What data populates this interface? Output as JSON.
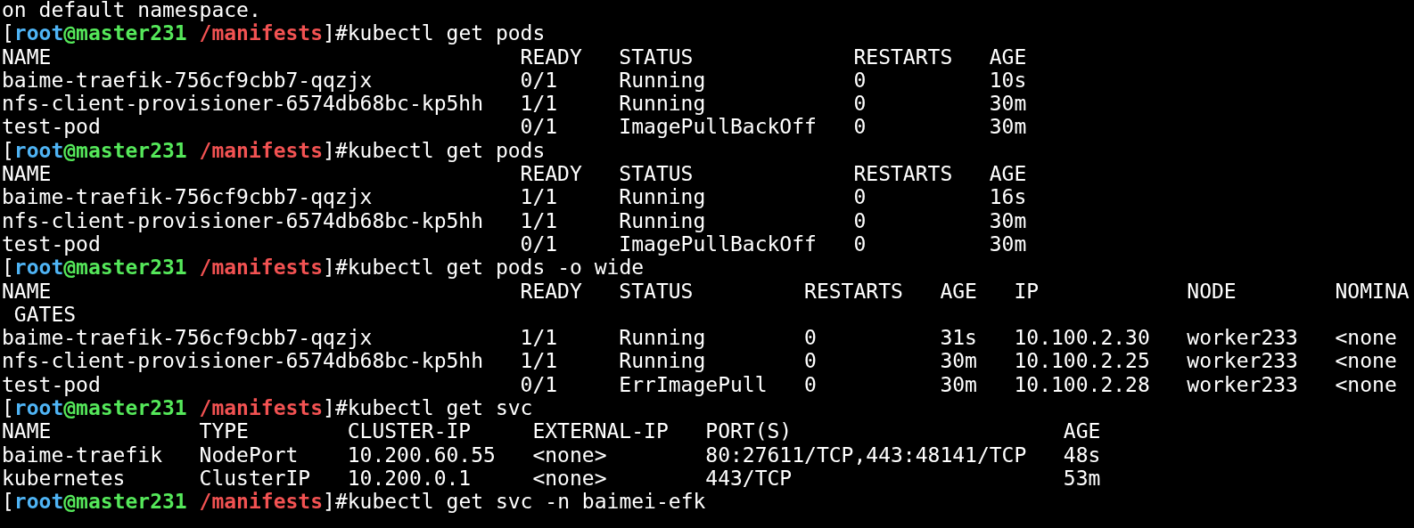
{
  "terminal": {
    "lines": [
      {
        "kind": "output",
        "text": "on default namespace."
      },
      {
        "kind": "prompt",
        "segments": [
          {
            "text": "[",
            "color": "#ffffff",
            "bold": false
          },
          {
            "text": "root",
            "color": "#4fb4f5",
            "bold": true
          },
          {
            "text": "@master231",
            "color": "#55e85a",
            "bold": true
          },
          {
            "text": " /manifests",
            "color": "#f25252",
            "bold": true
          },
          {
            "text": "]#kubectl get pods",
            "color": "#ffffff",
            "bold": false
          }
        ]
      },
      {
        "kind": "output",
        "text": "NAME                                      READY   STATUS             RESTARTS   AGE"
      },
      {
        "kind": "output",
        "text": "baime-traefik-756cf9cbb7-qqzjx            0/1     Running            0          10s"
      },
      {
        "kind": "output",
        "text": "nfs-client-provisioner-6574db68bc-kp5hh   1/1     Running            0          30m"
      },
      {
        "kind": "output",
        "text": "test-pod                                  0/1     ImagePullBackOff   0          30m"
      },
      {
        "kind": "prompt",
        "segments": [
          {
            "text": "[",
            "color": "#ffffff",
            "bold": false
          },
          {
            "text": "root",
            "color": "#4fb4f5",
            "bold": true
          },
          {
            "text": "@master231",
            "color": "#55e85a",
            "bold": true
          },
          {
            "text": " /manifests",
            "color": "#f25252",
            "bold": true
          },
          {
            "text": "]#kubectl get pods",
            "color": "#ffffff",
            "bold": false
          }
        ]
      },
      {
        "kind": "output",
        "text": "NAME                                      READY   STATUS             RESTARTS   AGE"
      },
      {
        "kind": "output",
        "text": "baime-traefik-756cf9cbb7-qqzjx            1/1     Running            0          16s"
      },
      {
        "kind": "output",
        "text": "nfs-client-provisioner-6574db68bc-kp5hh   1/1     Running            0          30m"
      },
      {
        "kind": "output",
        "text": "test-pod                                  0/1     ImagePullBackOff   0          30m"
      },
      {
        "kind": "prompt",
        "segments": [
          {
            "text": "[",
            "color": "#ffffff",
            "bold": false
          },
          {
            "text": "root",
            "color": "#4fb4f5",
            "bold": true
          },
          {
            "text": "@master231",
            "color": "#55e85a",
            "bold": true
          },
          {
            "text": " /manifests",
            "color": "#f25252",
            "bold": true
          },
          {
            "text": "]#kubectl get pods -o wide",
            "color": "#ffffff",
            "bold": false
          }
        ]
      },
      {
        "kind": "output",
        "text": "NAME                                      READY   STATUS         RESTARTS   AGE   IP            NODE        NOMINA"
      },
      {
        "kind": "output",
        "text": " GATES"
      },
      {
        "kind": "output",
        "text": "baime-traefik-756cf9cbb7-qqzjx            1/1     Running        0          31s   10.100.2.30   worker233   <none"
      },
      {
        "kind": "output",
        "text": "nfs-client-provisioner-6574db68bc-kp5hh   1/1     Running        0          30m   10.100.2.25   worker233   <none"
      },
      {
        "kind": "output",
        "text": "test-pod                                  0/1     ErrImagePull   0          30m   10.100.2.28   worker233   <none"
      },
      {
        "kind": "prompt",
        "segments": [
          {
            "text": "[",
            "color": "#ffffff",
            "bold": false
          },
          {
            "text": "root",
            "color": "#4fb4f5",
            "bold": true
          },
          {
            "text": "@master231",
            "color": "#55e85a",
            "bold": true
          },
          {
            "text": " /manifests",
            "color": "#f25252",
            "bold": true
          },
          {
            "text": "]#kubectl get svc",
            "color": "#ffffff",
            "bold": false
          }
        ]
      },
      {
        "kind": "output",
        "text": "NAME            TYPE        CLUSTER-IP     EXTERNAL-IP   PORT(S)                      AGE"
      },
      {
        "kind": "output",
        "text": "baime-traefik   NodePort    10.200.60.55   <none>        80:27611/TCP,443:48141/TCP   48s"
      },
      {
        "kind": "output",
        "text": "kubernetes      ClusterIP   10.200.0.1     <none>        443/TCP                      53m"
      },
      {
        "kind": "prompt",
        "segments": [
          {
            "text": "[",
            "color": "#ffffff",
            "bold": false
          },
          {
            "text": "root",
            "color": "#4fb4f5",
            "bold": true
          },
          {
            "text": "@master231",
            "color": "#55e85a",
            "bold": true
          },
          {
            "text": " /manifests",
            "color": "#f25252",
            "bold": true
          },
          {
            "text": "]#kubectl get svc -n baimei-efk",
            "color": "#ffffff",
            "bold": false
          }
        ]
      }
    ]
  }
}
